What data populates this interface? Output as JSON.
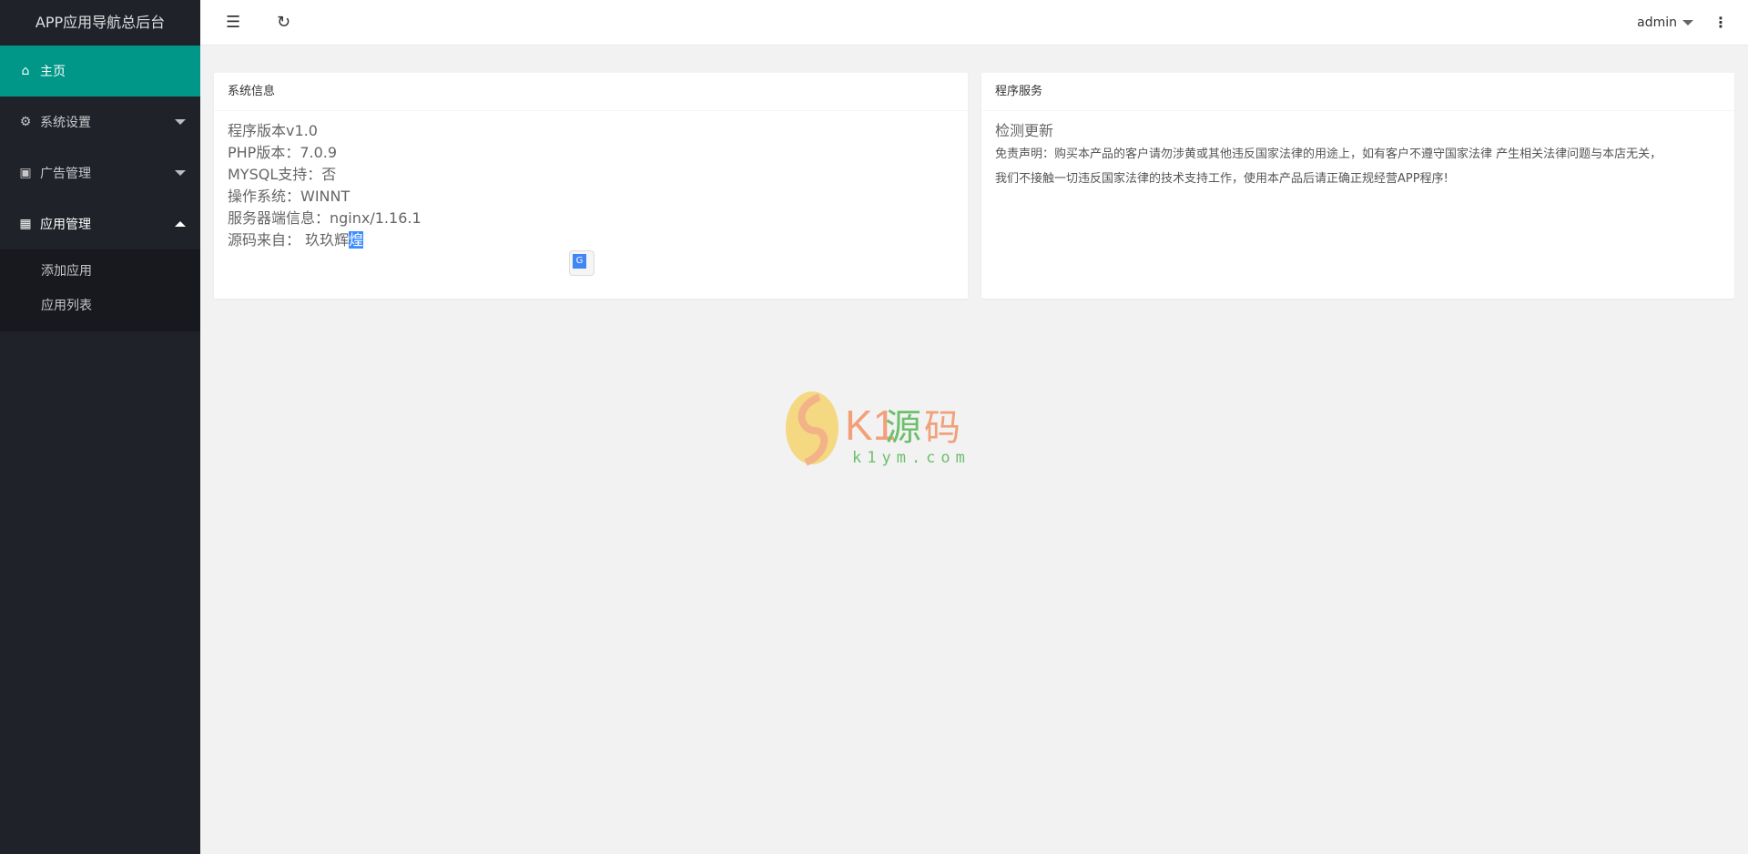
{
  "app_title": "APP应用导航总后台",
  "sidebar": {
    "items": [
      {
        "label": "主页",
        "icon": "home-icon"
      },
      {
        "label": "系统设置",
        "icon": "gear-icon"
      },
      {
        "label": "广告管理",
        "icon": "image-icon"
      },
      {
        "label": "应用管理",
        "icon": "apps-icon"
      }
    ],
    "sub_items": [
      "添加应用",
      "应用列表"
    ]
  },
  "header": {
    "user": "admin"
  },
  "system_card": {
    "title": "系统信息",
    "lines": [
      "程序版本v1.0",
      "PHP版本：7.0.9",
      "MYSQL支持：否",
      "操作系统：WINNT",
      "服务器端信息：nginx/1.16.1"
    ],
    "source_label": "源码来自： 玖玖辉",
    "source_highlight": "煌"
  },
  "service_card": {
    "title": "程序服务",
    "check_update": "检测更新",
    "disclaimer_1": "免责声明：购买本产品的客户请勿涉黄或其他违反国家法律的用途上，如有客户不遵守国家法律 产生相关法律问题与本店无关，",
    "disclaimer_2": "我们不接触一切违反国家法律的技术支持工作，使用本产品后请正确正规经营APP程序!"
  },
  "watermark": {
    "text": "K1源码",
    "url_text": "k1ym.com"
  }
}
